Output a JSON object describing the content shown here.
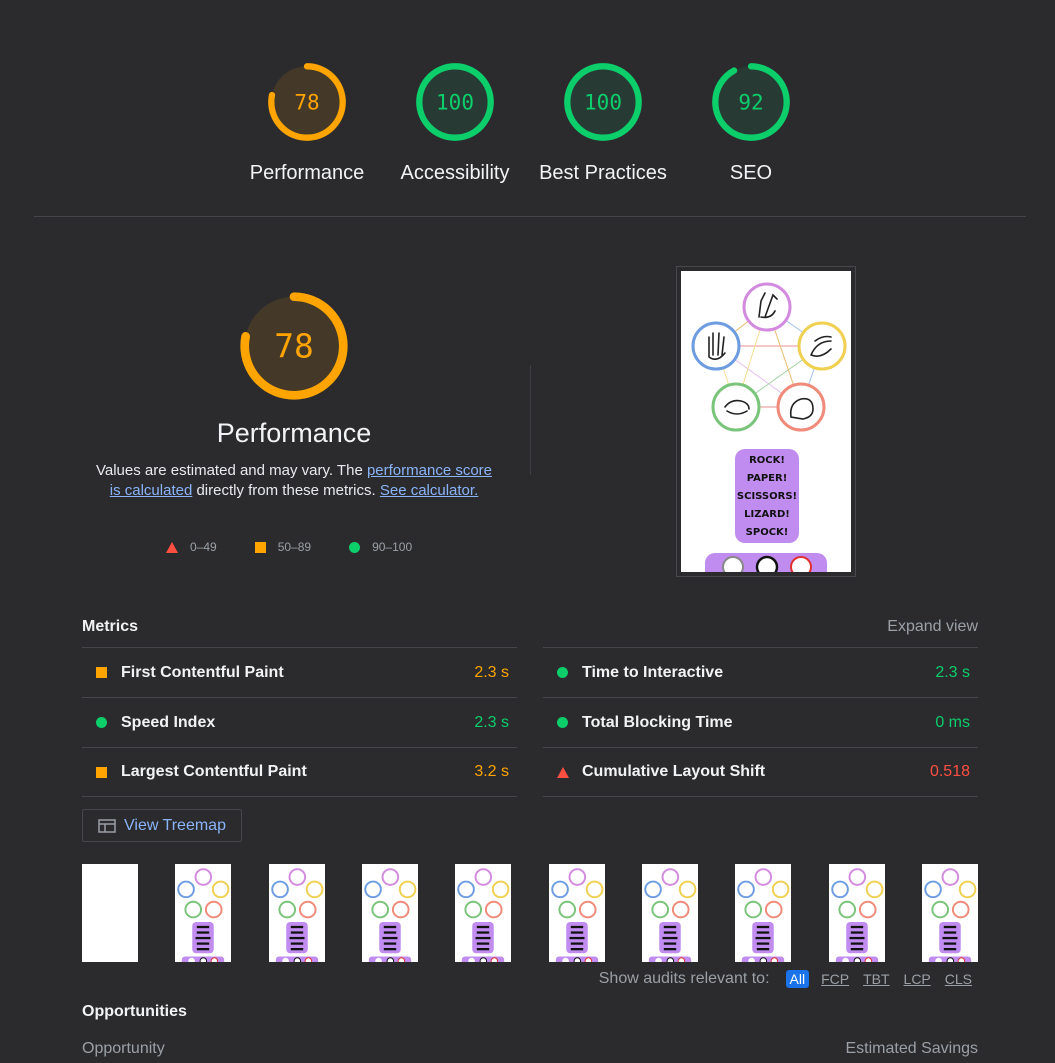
{
  "colors": {
    "background": "#2b2b2e",
    "fail": "#ff4e42",
    "average": "#ffa400",
    "pass": "#0cce6b",
    "link": "#8ab4f8",
    "accent_blue": "#1a73e8"
  },
  "top_gauges": [
    {
      "label": "Performance",
      "score": "78",
      "status": "average",
      "fraction": 0.78
    },
    {
      "label": "Accessibility",
      "score": "100",
      "status": "pass",
      "fraction": 1.0
    },
    {
      "label": "Best Practices",
      "score": "100",
      "status": "pass",
      "fraction": 1.0
    },
    {
      "label": "SEO",
      "score": "92",
      "status": "pass",
      "fraction": 0.92
    }
  ],
  "performance": {
    "score": "78",
    "fraction": 0.78,
    "title": "Performance",
    "desc_before": "Values are estimated and may vary. The ",
    "desc_link1": "performance score is calculated",
    "desc_middle": " directly from these metrics. ",
    "desc_link2": "See calculator.",
    "legend": {
      "fail": "0–49",
      "average": "50–89",
      "pass": "90–100"
    }
  },
  "screenshot_content": {
    "button_text": "ROCK!\nPAPER!\nSCISSORS!\nLIZARD!\nSPOCK!"
  },
  "metrics": {
    "title": "Metrics",
    "expand_label": "Expand view",
    "items": [
      {
        "name": "First Contentful Paint",
        "value": "2.3 s",
        "status": "average",
        "icon": "square-icon"
      },
      {
        "name": "Time to Interactive",
        "value": "2.3 s",
        "status": "pass",
        "icon": "circle-icon"
      },
      {
        "name": "Speed Index",
        "value": "2.3 s",
        "status": "pass",
        "icon": "circle-icon"
      },
      {
        "name": "Total Blocking Time",
        "value": "0 ms",
        "status": "pass",
        "icon": "circle-icon"
      },
      {
        "name": "Largest Contentful Paint",
        "value": "3.2 s",
        "status": "average",
        "icon": "square-icon"
      },
      {
        "name": "Cumulative Layout Shift",
        "value": "0.518",
        "status": "fail",
        "icon": "triangle-icon"
      }
    ]
  },
  "treemap_button": {
    "label": "View Treemap",
    "icon": "treemap-icon"
  },
  "filmstrip": {
    "frame_count": 10,
    "blank_frames": 1
  },
  "audit_filter": {
    "label": "Show audits relevant to:",
    "options": [
      "All",
      "FCP",
      "TBT",
      "LCP",
      "CLS"
    ],
    "active": "All"
  },
  "opportunities": {
    "title": "Opportunities",
    "col_left": "Opportunity",
    "col_right": "Estimated Savings"
  }
}
